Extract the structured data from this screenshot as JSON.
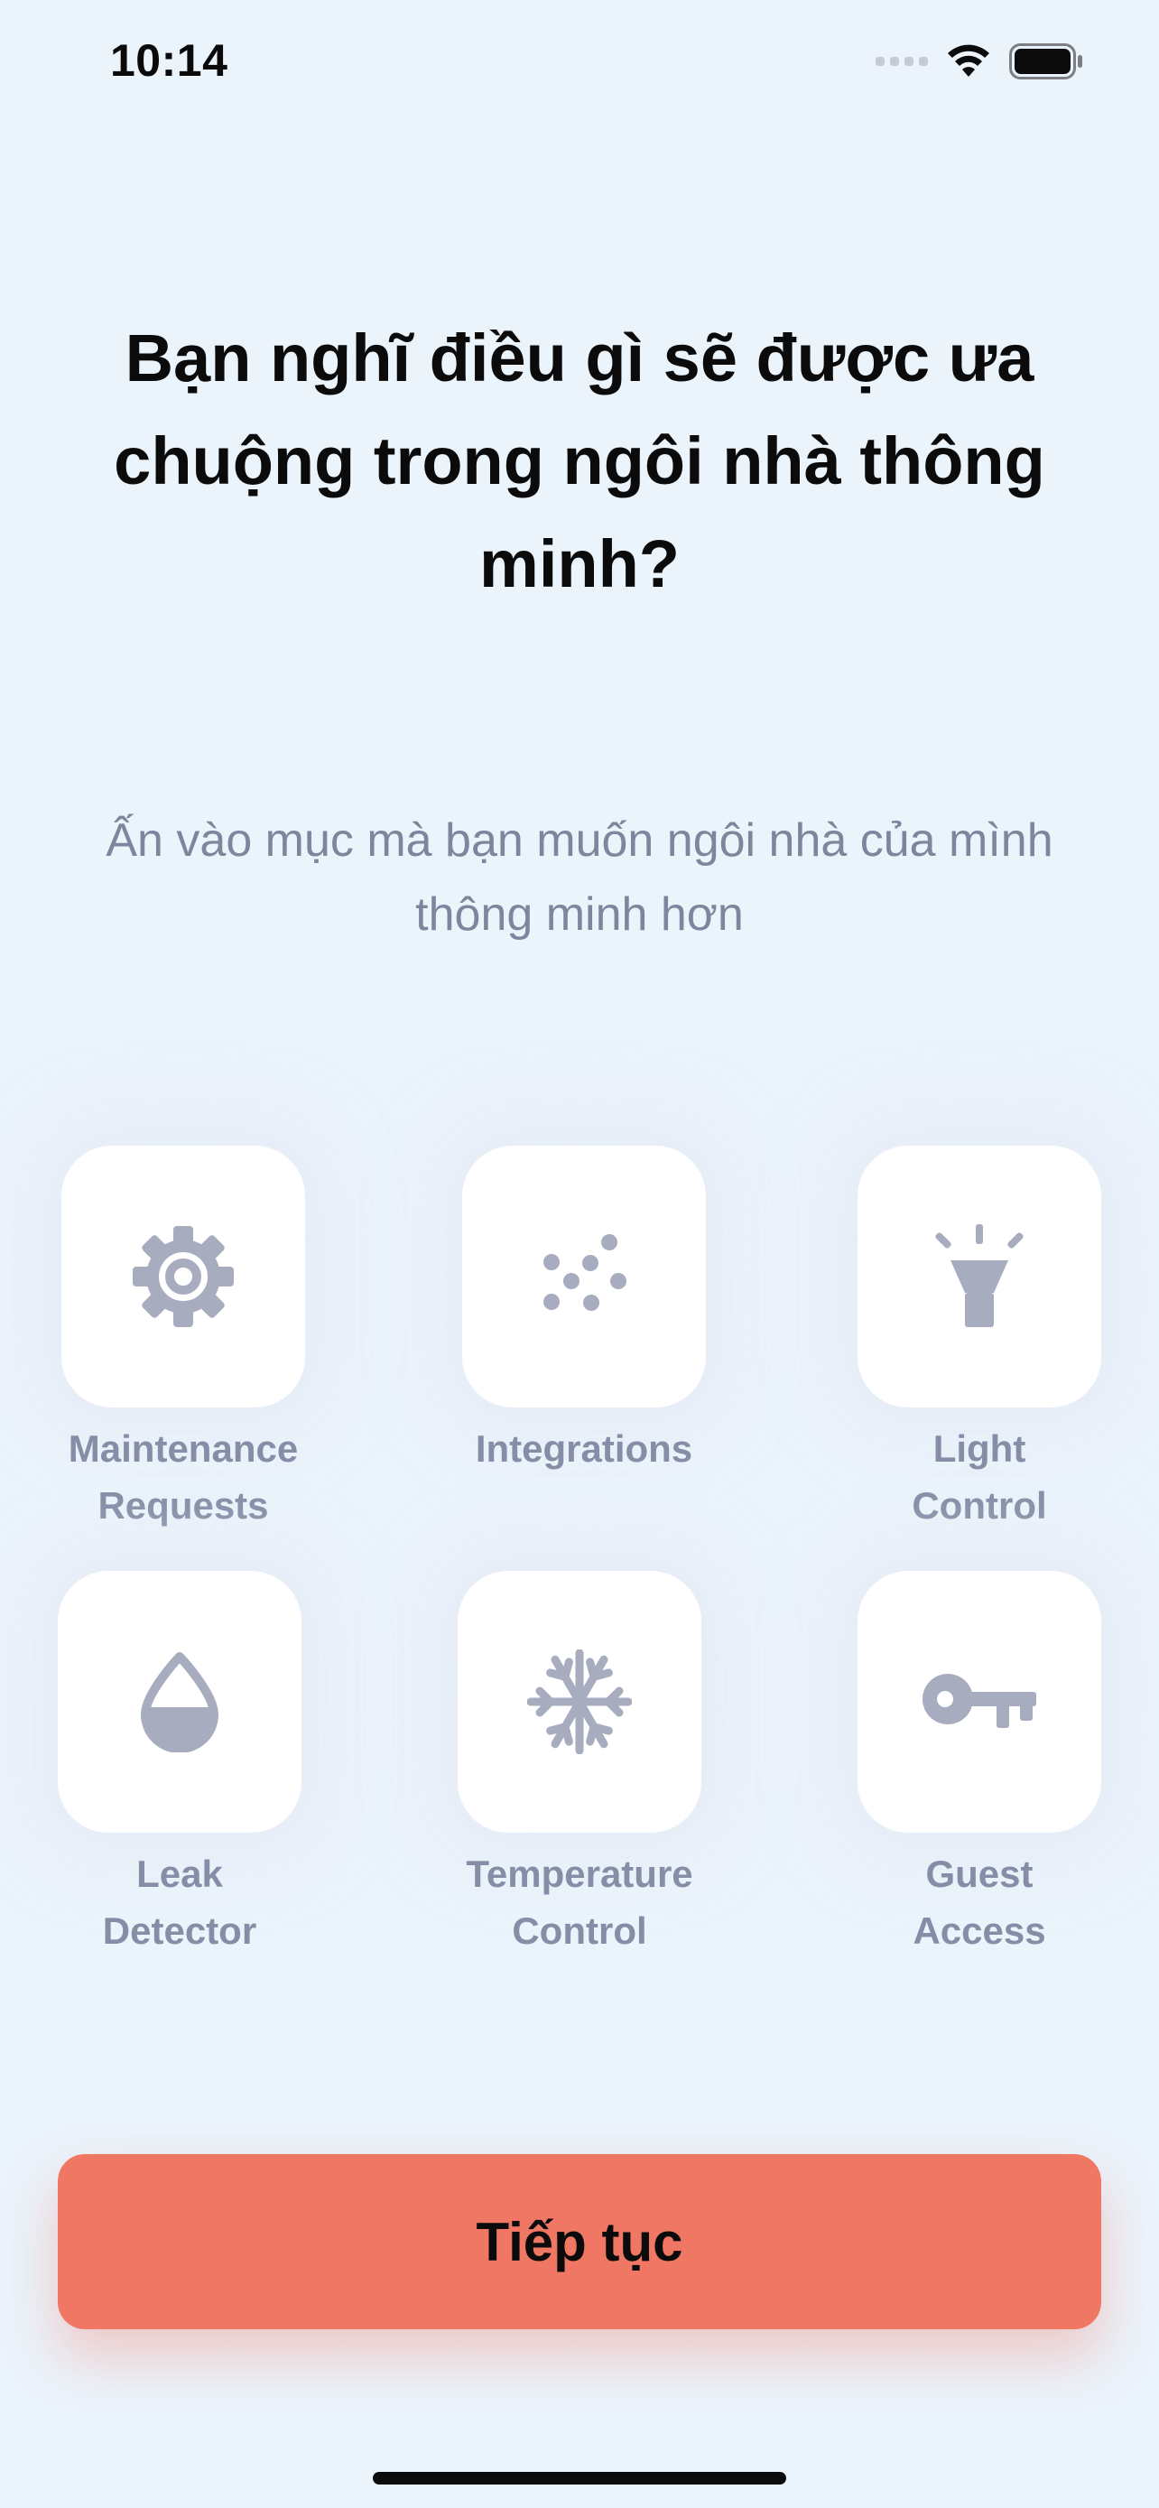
{
  "status_bar": {
    "time": "10:14",
    "signal_icon": "cellular-signal-icon",
    "wifi_icon": "wifi-icon",
    "battery_icon": "battery-icon"
  },
  "page": {
    "title": "Bạn nghĩ điều gì sẽ được ưa chuộng trong ngôi nhà thông minh?",
    "subtitle": "Ấn vào mục mà bạn muốn ngôi nhà của mình thông minh hơn"
  },
  "features": [
    {
      "label": "Maintenance\nRequests",
      "icon": "gear-icon"
    },
    {
      "label": "Integrations",
      "icon": "dots-cluster-icon"
    },
    {
      "label": "Light\nControl",
      "icon": "flashlight-icon"
    },
    {
      "label": "Leak\nDetector",
      "icon": "water-drop-icon"
    },
    {
      "label": "Temperature\nControl",
      "icon": "snowflake-icon"
    },
    {
      "label": "Guest\nAccess",
      "icon": "key-icon"
    }
  ],
  "actions": {
    "continue_label": "Tiếp tục"
  },
  "colors": {
    "background": "#EBF3FB",
    "accent": "#F07763",
    "icon": "#A7ADBF",
    "label": "#858EA6"
  }
}
